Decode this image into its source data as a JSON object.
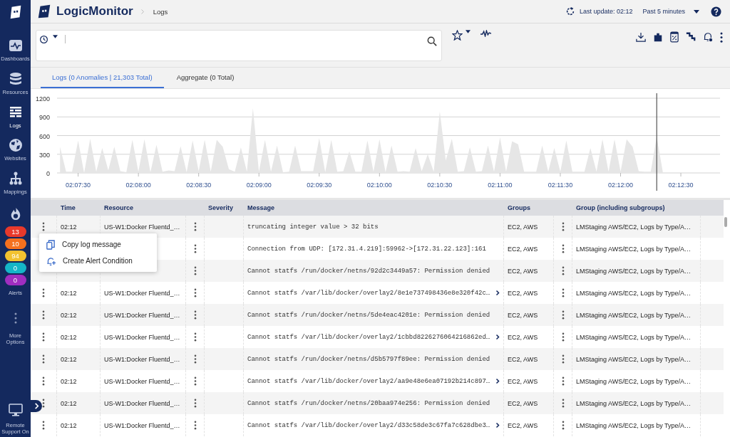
{
  "sidebar": {
    "items": [
      {
        "label": "Dashboards",
        "kind": "pulse",
        "selected": false
      },
      {
        "label": "Resources",
        "kind": "database",
        "selected": false
      },
      {
        "label": "Logs",
        "kind": "logs",
        "selected": true
      },
      {
        "label": "Websites",
        "kind": "globe",
        "selected": false
      },
      {
        "label": "Mappings",
        "kind": "tree",
        "selected": false
      }
    ],
    "alerts": {
      "label": "Alerts",
      "badges": [
        {
          "count": "13",
          "color": "#e8392b"
        },
        {
          "count": "10",
          "color": "#f5701e"
        },
        {
          "count": "94",
          "color": "#f2c230"
        },
        {
          "count": "0",
          "color": "#14b6c8"
        },
        {
          "count": "0",
          "color": "#a02ec0"
        }
      ]
    },
    "more": {
      "label": "More Options"
    },
    "remote": {
      "label": "Remote Support On"
    }
  },
  "header": {
    "brand": "LogicMonitor",
    "breadcrumb": "Logs",
    "last_update": "Last update: 02:12",
    "time_range": "Past 5 minutes"
  },
  "tabs": [
    {
      "label": "Logs (0 Anomalies | 21,303 Total)",
      "selected": true
    },
    {
      "label": "Aggregate (0 Total)",
      "selected": false
    }
  ],
  "chart_data": {
    "type": "area",
    "grid": true,
    "ylim": [
      0,
      1200
    ],
    "yticks": [
      0,
      300,
      600,
      900,
      1200
    ],
    "categories": [
      null,
      null,
      null,
      "02:07:30",
      null,
      null,
      null,
      null,
      null,
      null,
      null,
      null,
      null,
      "02:08:00",
      null,
      null,
      null,
      null,
      null,
      null,
      null,
      null,
      null,
      "02:08:30",
      null,
      null,
      null,
      null,
      null,
      null,
      null,
      null,
      null,
      "02:09:00",
      null,
      null,
      null,
      null,
      null,
      null,
      null,
      null,
      null,
      "02:09:30",
      null,
      null,
      null,
      null,
      null,
      null,
      null,
      null,
      null,
      "02:10:00",
      null,
      null,
      null,
      null,
      null,
      null,
      null,
      null,
      null,
      "02:10:30",
      null,
      null,
      null,
      null,
      null,
      null,
      null,
      null,
      null,
      "02:11:00",
      null,
      null,
      null,
      null,
      null,
      null,
      null,
      null,
      null,
      "02:11:30",
      null,
      null,
      null,
      null,
      null,
      null,
      null,
      null,
      null,
      "02:12:00",
      null,
      null,
      null,
      null,
      null,
      null,
      null,
      null,
      null,
      "02:12:30",
      null,
      null,
      null,
      null,
      null,
      null
    ],
    "series": [
      {
        "color": "#e6e6e6",
        "values": [
          420,
          20,
          20,
          520,
          0,
          550,
          20,
          400,
          40,
          420,
          30,
          10,
          530,
          20,
          540,
          10,
          450,
          20,
          40,
          30,
          430,
          10,
          520,
          30,
          530,
          20,
          530,
          420,
          60,
          20,
          410,
          20,
          1040,
          20,
          530,
          20,
          440,
          10,
          20,
          440,
          30,
          30,
          30,
          560,
          10,
          530,
          20,
          30,
          350,
          20,
          20,
          520,
          20,
          540,
          10,
          440,
          20,
          30,
          20,
          400,
          30,
          300,
          20,
          990,
          200,
          550,
          20,
          30,
          410,
          20,
          30,
          440,
          20,
          570,
          20,
          510,
          460,
          20,
          20,
          20,
          440,
          20,
          400,
          20,
          520,
          20,
          20,
          20,
          400,
          20,
          540,
          20,
          540,
          20,
          540,
          420,
          30,
          20,
          20,
          580,
          20,
          null,
          null,
          null,
          null,
          null,
          null,
          null,
          null,
          null
        ]
      }
    ]
  },
  "table": {
    "columns": [
      "Time",
      "Resource",
      "Severity",
      "Message",
      "Groups",
      "Group (including subgroups)"
    ],
    "rows": [
      {
        "time": "02:12",
        "resource": "US-W1:Docker Fluentd_…",
        "message": "truncating integer value > 32 bits",
        "expandable": false,
        "groups": "EC2, AWS",
        "group_full": "LMStaging AWS/EC2, Logs by Type/A…"
      },
      {
        "message": "Connection from UDP: [172.31.4.219]:59962->[172.31.22.123]:161",
        "expandable": false,
        "groups": "EC2, AWS",
        "group_full": "LMStaging AWS/EC2, Logs by Type/A…"
      },
      {
        "message": "Cannot statfs /run/docker/netns/92d2c3449a57: Permission denied",
        "expandable": false,
        "groups": "EC2, AWS",
        "group_full": "LMStaging AWS/EC2, Logs by Type/A…"
      },
      {
        "time": "02:12",
        "resource": "US-W1:Docker Fluentd_…",
        "message": "Cannot statfs /var/lib/docker/overlay2/8e1e737498436e8e320f42c…",
        "expandable": true,
        "groups": "EC2, AWS",
        "group_full": "LMStaging AWS/EC2, Logs by Type/A…"
      },
      {
        "time": "02:12",
        "resource": "US-W1:Docker Fluentd_…",
        "message": "Cannot statfs /run/docker/netns/5de4eac4201e: Permission denied",
        "expandable": false,
        "groups": "EC2, AWS",
        "group_full": "LMStaging AWS/EC2, Logs by Type/A…"
      },
      {
        "time": "02:12",
        "resource": "US-W1:Docker Fluentd_…",
        "message": "Cannot statfs /var/lib/docker/overlay2/1cbbd8226276064216862ed…",
        "expandable": true,
        "groups": "EC2, AWS",
        "group_full": "LMStaging AWS/EC2, Logs by Type/A…"
      },
      {
        "time": "02:12",
        "resource": "US-W1:Docker Fluentd_…",
        "message": "Cannot statfs /run/docker/netns/d5b5797f89ee: Permission denied",
        "expandable": false,
        "groups": "EC2, AWS",
        "group_full": "LMStaging AWS/EC2, Logs by Type/A…"
      },
      {
        "time": "02:12",
        "resource": "US-W1:Docker Fluentd_…",
        "message": "Cannot statfs /var/lib/docker/overlay2/aa9e48e6ea07192b214c897…",
        "expandable": true,
        "groups": "EC2, AWS",
        "group_full": "LMStaging AWS/EC2, Logs by Type/A…"
      },
      {
        "time": "02:12",
        "resource": "US-W1:Docker Fluentd_…",
        "message": "Cannot statfs /run/docker/netns/20baa974e256: Permission denied",
        "expandable": false,
        "groups": "EC2, AWS",
        "group_full": "LMStaging AWS/EC2, Logs by Type/A…"
      },
      {
        "time": "02:12",
        "resource": "US-W1:Docker Fluentd_…",
        "message": "Cannot statfs /var/lib/docker/overlay2/d33c58de3c67fa7c628dbe3…",
        "expandable": true,
        "groups": "EC2, AWS",
        "group_full": "LMStaging AWS/EC2, Logs by Type/A…"
      }
    ]
  },
  "context_menu": {
    "items": [
      {
        "label": "Copy log message",
        "kind": "copy"
      },
      {
        "label": "Create Alert Condition",
        "kind": "bell-plus"
      }
    ]
  }
}
